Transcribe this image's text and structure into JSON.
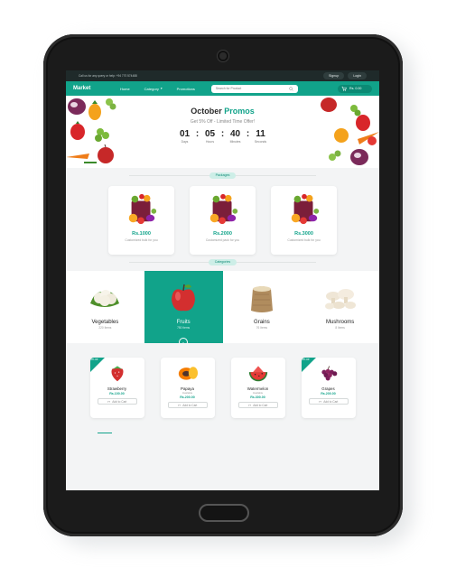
{
  "topbar": {
    "info": "Call us for any query or help: +94 770 574488",
    "signup": "Signup",
    "login": "Login"
  },
  "nav": {
    "brand": "Market",
    "home": "Home",
    "category": "Category",
    "promotions": "Promotions",
    "search_placeholder": "Search for Product",
    "cart": "Rs. 0.00"
  },
  "hero": {
    "title_start": "October ",
    "title_accent": "Promos",
    "subtitle": "Get 5% Off - Limited Time Offer!",
    "countdown": [
      {
        "value": "01",
        "label": "Days"
      },
      {
        "value": "05",
        "label": "Hours"
      },
      {
        "value": "40",
        "label": "Minutes"
      },
      {
        "value": "11",
        "label": "Seconds"
      }
    ]
  },
  "packages_label": "Packages",
  "packages": [
    {
      "price": "Rs.1000",
      "desc": "Customized bulk for you"
    },
    {
      "price": "Rs.2000",
      "desc": "Customized pack for you"
    },
    {
      "price": "Rs.3000",
      "desc": "Customized bulk for you"
    }
  ],
  "categories_label": "Categories",
  "categories": [
    {
      "name": "Vegetables",
      "count": "220 Items",
      "active": false
    },
    {
      "name": "Fruits",
      "count": "750 Items",
      "active": true
    },
    {
      "name": "Grains",
      "count": "76 Items",
      "active": false
    },
    {
      "name": "Mushrooms",
      "count": "8 Items",
      "active": false
    }
  ],
  "products": [
    {
      "name": "Strawberry",
      "sub": "",
      "price": "Rs.100.00",
      "ribbon": "5% Off",
      "button": "Add to Cart"
    },
    {
      "name": "Papaya",
      "sub": "Available",
      "price": "Rs.200.00",
      "ribbon": "",
      "button": "Add to Cart"
    },
    {
      "name": "Watermelon",
      "sub": "Available",
      "price": "Rs.300.00",
      "ribbon": "",
      "button": "Add to Cart"
    },
    {
      "name": "Grapes",
      "sub": "",
      "price": "Rs.200.00",
      "ribbon": "5% Off",
      "button": "Add to Cart"
    }
  ],
  "colors": {
    "accent": "#11a38a",
    "topbar": "#1f2a2a"
  }
}
